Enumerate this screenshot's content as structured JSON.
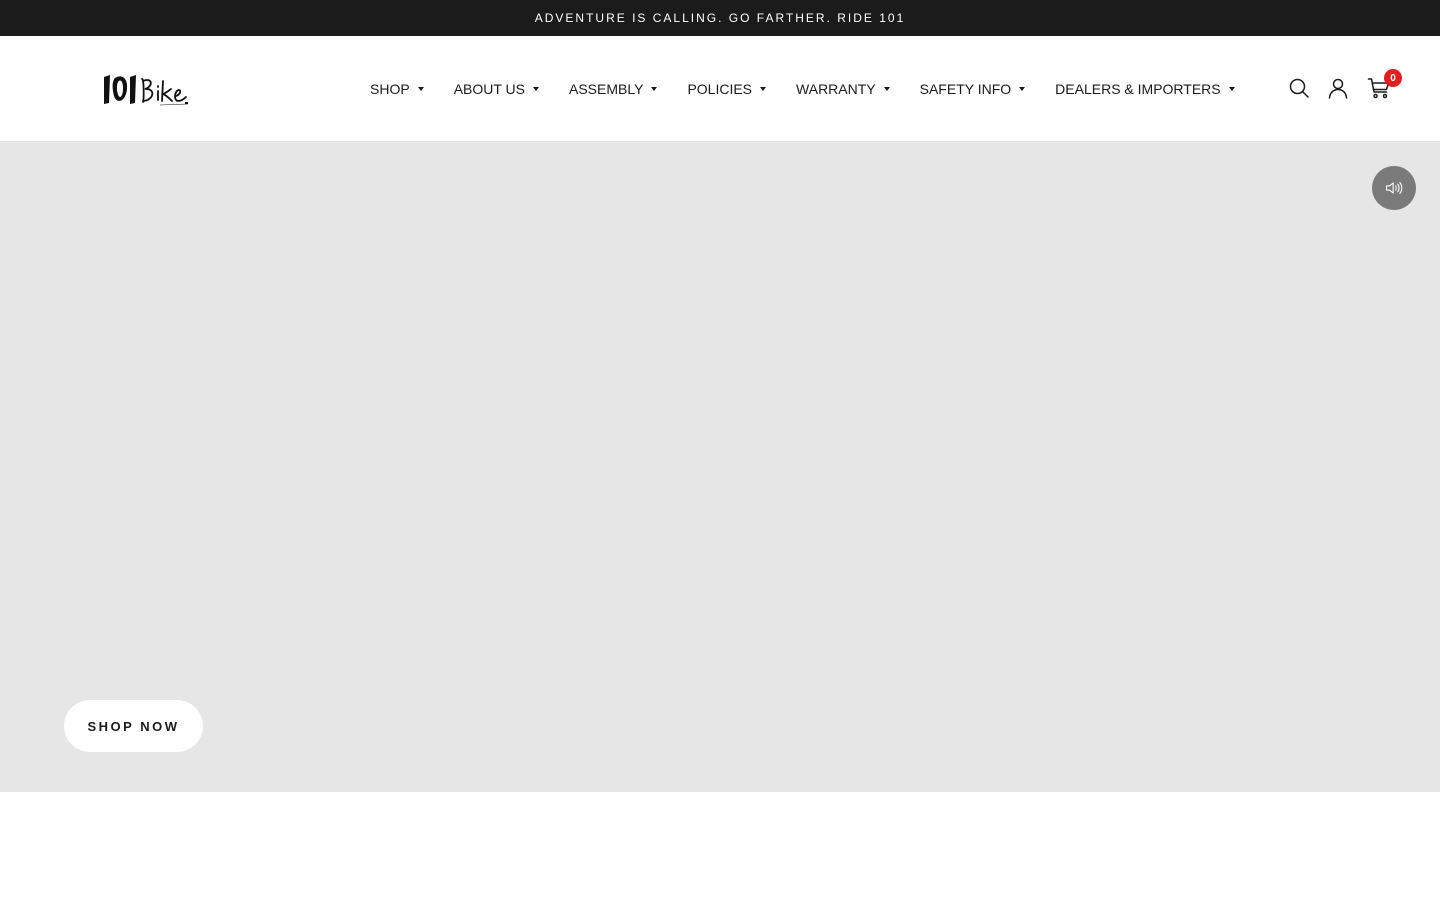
{
  "announcement": {
    "text": "ADVENTURE IS CALLING. GO FARTHER. RIDE 101"
  },
  "header": {
    "logo_text": "101Bike",
    "nav": [
      {
        "label": "SHOP"
      },
      {
        "label": "ABOUT US"
      },
      {
        "label": "ASSEMBLY"
      },
      {
        "label": "POLICIES"
      },
      {
        "label": "WARRANTY"
      },
      {
        "label": "SAFETY INFO"
      },
      {
        "label": "DEALERS & IMPORTERS"
      }
    ],
    "icons": {
      "search": "search-icon",
      "account": "account-icon",
      "cart": "cart-icon"
    },
    "cart_count": "0"
  },
  "hero": {
    "mute_icon": "speaker-icon",
    "cta_label": "SHOP NOW",
    "background_color": "#e6e6e6"
  },
  "colors": {
    "announcement_bg": "#1b1b1b",
    "cart_badge": "#e02020",
    "text": "#1b1b1b"
  }
}
